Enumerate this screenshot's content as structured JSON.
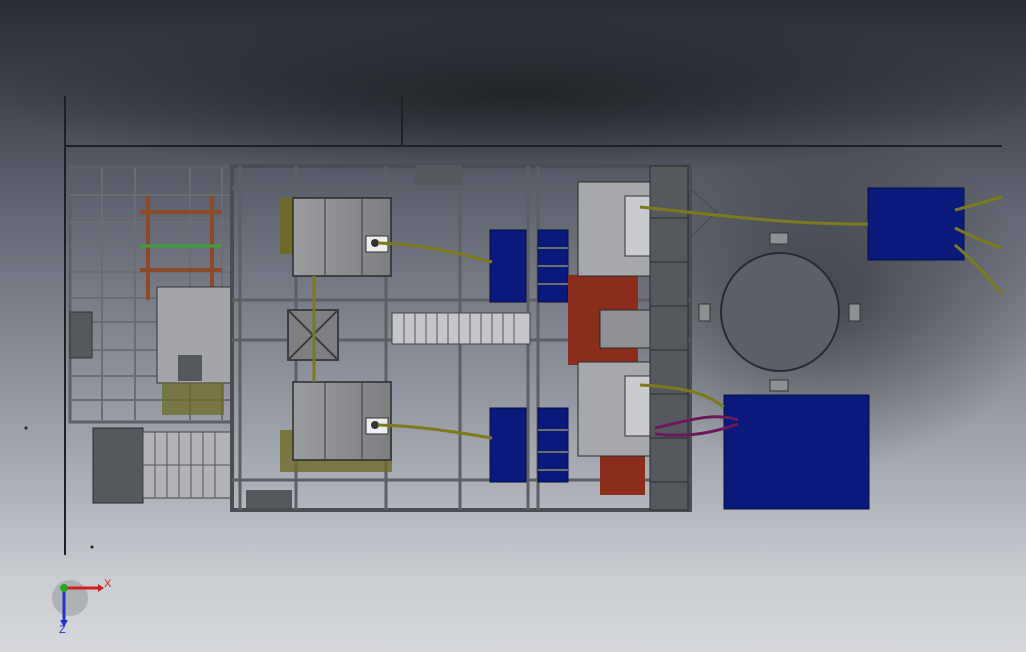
{
  "viewport": {
    "kind": "cad-3d-top-view",
    "background_top": "#2a2d33",
    "background_bottom": "#d6d8dc"
  },
  "triad": {
    "x_label": "X",
    "z_label": "Z",
    "y_color": "#22aa22",
    "x_color": "#cc2222",
    "z_color": "#2233cc"
  },
  "colors": {
    "frame": "#5c5f63",
    "frame_dark": "#3c3e42",
    "panel_gray": "#8e9093",
    "navy_box": "#0b1a7a",
    "olive_cable": "#7c7a1e",
    "rust": "#8b3a1c",
    "green_rail": "#3aa13a",
    "purple_cable": "#6a1a5a"
  },
  "model": {
    "name": "assembly-top-view",
    "components": [
      "main-frame",
      "left-subframe",
      "control-cabinet-top",
      "control-cabinet-bottom",
      "motor-box-top",
      "motor-box-bottom",
      "roller-conveyor",
      "right-stack-module",
      "round-tank",
      "navy-unit-top-right",
      "navy-unit-bottom-right"
    ]
  }
}
